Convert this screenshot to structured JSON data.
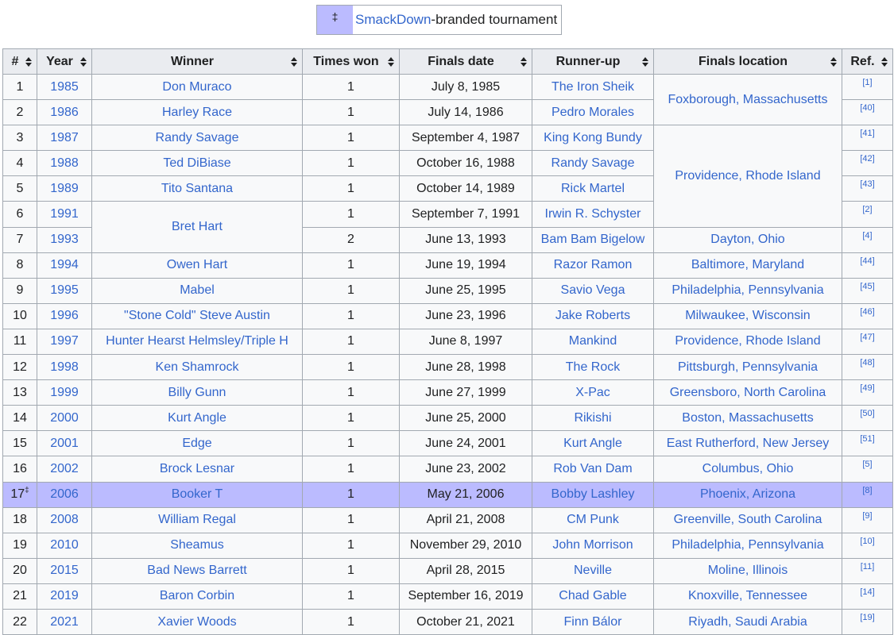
{
  "legend": {
    "symbol": "‡",
    "link": "SmackDown",
    "suffix": "-branded tournament"
  },
  "headers": [
    "#",
    "Year",
    "Winner",
    "Times won",
    "Finals date",
    "Runner-up",
    "Finals location",
    "Ref."
  ],
  "rows": [
    {
      "num": "1",
      "year": "1985",
      "winner": "Don Muraco",
      "times": "1",
      "date": "July 8, 1985",
      "runner": "The Iron Sheik",
      "location": "Foxborough, Massachusetts",
      "ref": "[1]"
    },
    {
      "num": "2",
      "year": "1986",
      "winner": "Harley Race",
      "times": "1",
      "date": "July 14, 1986",
      "runner": "Pedro Morales",
      "ref": "[40]"
    },
    {
      "num": "3",
      "year": "1987",
      "winner": "Randy Savage",
      "times": "1",
      "date": "September 4, 1987",
      "runner": "King Kong Bundy",
      "location": "Providence, Rhode Island",
      "ref": "[41]"
    },
    {
      "num": "4",
      "year": "1988",
      "winner": "Ted DiBiase",
      "times": "1",
      "date": "October 16, 1988",
      "runner": "Randy Savage",
      "ref": "[42]"
    },
    {
      "num": "5",
      "year": "1989",
      "winner": "Tito Santana",
      "times": "1",
      "date": "October 14, 1989",
      "runner": "Rick Martel",
      "ref": "[43]"
    },
    {
      "num": "6",
      "year": "1991",
      "winner": "Bret Hart",
      "times": "1",
      "date": "September 7, 1991",
      "runner": "Irwin R. Schyster",
      "ref": "[2]"
    },
    {
      "num": "7",
      "year": "1993",
      "times": "2",
      "date": "June 13, 1993",
      "runner": "Bam Bam Bigelow",
      "location": "Dayton, Ohio",
      "ref": "[4]"
    },
    {
      "num": "8",
      "year": "1994",
      "winner": "Owen Hart",
      "times": "1",
      "date": "June 19, 1994",
      "runner": "Razor Ramon",
      "location": "Baltimore, Maryland",
      "ref": "[44]"
    },
    {
      "num": "9",
      "year": "1995",
      "winner": "Mabel",
      "times": "1",
      "date": "June 25, 1995",
      "runner": "Savio Vega",
      "location": "Philadelphia, Pennsylvania",
      "ref": "[45]"
    },
    {
      "num": "10",
      "year": "1996",
      "winner": "\"Stone Cold\" Steve Austin",
      "times": "1",
      "date": "June 23, 1996",
      "runner": "Jake Roberts",
      "location": "Milwaukee, Wisconsin",
      "ref": "[46]"
    },
    {
      "num": "11",
      "year": "1997",
      "winner": "Hunter Hearst Helmsley/Triple H",
      "times": "1",
      "date": "June 8, 1997",
      "runner": "Mankind",
      "location": "Providence, Rhode Island",
      "ref": "[47]"
    },
    {
      "num": "12",
      "year": "1998",
      "winner": "Ken Shamrock",
      "times": "1",
      "date": "June 28, 1998",
      "runner": "The Rock",
      "location": "Pittsburgh, Pennsylvania",
      "ref": "[48]"
    },
    {
      "num": "13",
      "year": "1999",
      "winner": "Billy Gunn",
      "times": "1",
      "date": "June 27, 1999",
      "runner": "X-Pac",
      "location": "Greensboro, North Carolina",
      "ref": "[49]"
    },
    {
      "num": "14",
      "year": "2000",
      "winner": "Kurt Angle",
      "times": "1",
      "date": "June 25, 2000",
      "runner": "Rikishi",
      "location": "Boston, Massachusetts",
      "ref": "[50]"
    },
    {
      "num": "15",
      "year": "2001",
      "winner": "Edge",
      "times": "1",
      "date": "June 24, 2001",
      "runner": "Kurt Angle",
      "location": "East Rutherford, New Jersey",
      "ref": "[51]"
    },
    {
      "num": "16",
      "year": "2002",
      "winner": "Brock Lesnar",
      "times": "1",
      "date": "June 23, 2002",
      "runner": "Rob Van Dam",
      "location": "Columbus, Ohio",
      "ref": "[5]"
    },
    {
      "num": "17",
      "mark": "‡",
      "year": "2006",
      "winner": "Booker T",
      "times": "1",
      "date": "May 21, 2006",
      "runner": "Bobby Lashley",
      "location": "Phoenix, Arizona",
      "ref": "[8]",
      "highlight": true
    },
    {
      "num": "18",
      "year": "2008",
      "winner": "William Regal",
      "times": "1",
      "date": "April 21, 2008",
      "runner": "CM Punk",
      "location": "Greenville, South Carolina",
      "ref": "[9]"
    },
    {
      "num": "19",
      "year": "2010",
      "winner": "Sheamus",
      "times": "1",
      "date": "November 29, 2010",
      "runner": "John Morrison",
      "location": "Philadelphia, Pennsylvania",
      "ref": "[10]"
    },
    {
      "num": "20",
      "year": "2015",
      "winner": "Bad News Barrett",
      "times": "1",
      "date": "April 28, 2015",
      "runner": "Neville",
      "location": "Moline, Illinois",
      "ref": "[11]"
    },
    {
      "num": "21",
      "year": "2019",
      "winner": "Baron Corbin",
      "times": "1",
      "date": "September 16, 2019",
      "runner": "Chad Gable",
      "location": "Knoxville, Tennessee",
      "ref": "[14]"
    },
    {
      "num": "22",
      "year": "2021",
      "winner": "Xavier Woods",
      "times": "1",
      "date": "October 21, 2021",
      "runner": "Finn Bálor",
      "location": "Riyadh, Saudi Arabia",
      "ref": "[19]"
    }
  ],
  "colors": {
    "header_bg": "#eaecf0",
    "cell_bg": "#f8f9fa",
    "highlight": "#bbbbff",
    "link": "#3366cc",
    "border": "#a2a9b1"
  }
}
